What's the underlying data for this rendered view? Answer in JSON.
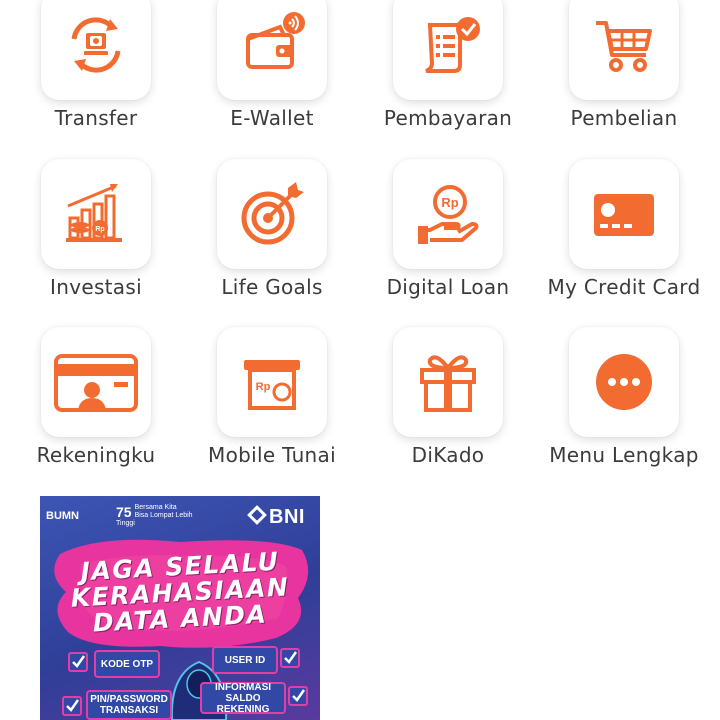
{
  "menu": {
    "items": [
      {
        "label": "Transfer",
        "icon": "transfer-icon"
      },
      {
        "label": "E-Wallet",
        "icon": "wallet-icon"
      },
      {
        "label": "Pembayaran",
        "icon": "payment-receipt-icon"
      },
      {
        "label": "Pembelian",
        "icon": "shopping-cart-icon"
      },
      {
        "label": "Investasi",
        "icon": "investment-chart-icon"
      },
      {
        "label": "Life Goals",
        "icon": "target-icon"
      },
      {
        "label": "Digital Loan",
        "icon": "loan-hand-coin-icon"
      },
      {
        "label": "My Credit Card",
        "icon": "credit-card-icon"
      },
      {
        "label": "Rekeningku",
        "icon": "account-card-icon"
      },
      {
        "label": "Mobile Tunai",
        "icon": "atm-cash-icon"
      },
      {
        "label": "DiKado",
        "icon": "gift-icon"
      },
      {
        "label": "Menu Lengkap",
        "icon": "more-dots-icon"
      }
    ]
  },
  "banner": {
    "bumn": "BUMN",
    "anniversary_line1": "Bersama Kita",
    "anniversary_line2": "Bisa Lompat Lebih Tinggi",
    "anniversary_number": "75",
    "brand": "BNI",
    "headline_line1": "JAGA SELALU",
    "headline_line2": "KERAHASIAAN",
    "headline_line3": "DATA ANDA",
    "item_kode_otp": "KODE OTP",
    "item_user_id": "USER ID",
    "item_password": "PIN/PASSWORD TRANSAKSI",
    "item_informasi": "INFORMASI SALDO REKENING"
  },
  "colors": {
    "accent": "#f26c32",
    "label_text": "#3b3b3b",
    "banner_blue": "#3148a6",
    "banner_pink": "#e43da8"
  }
}
